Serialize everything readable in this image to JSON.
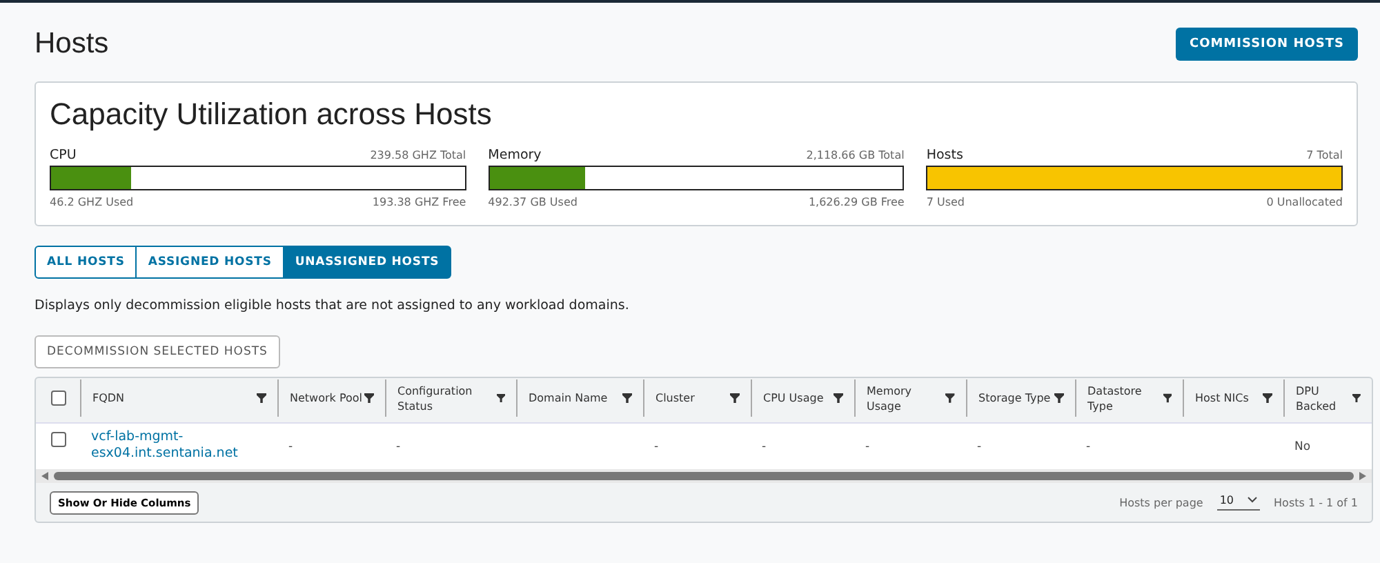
{
  "page": {
    "title": "Hosts",
    "action": "COMMISSION HOSTS"
  },
  "capacity": {
    "title": "Capacity Utilization across Hosts",
    "meters": [
      {
        "label": "CPU",
        "total": "239.58 GHZ Total",
        "level": 0.193,
        "used": "46.2 GHZ Used",
        "free": "193.38 GHZ Free",
        "color": "#4a9010"
      },
      {
        "label": "Memory",
        "total": "2,118.66 GB Total",
        "level": 0.232,
        "used": "492.37 GB Used",
        "free": "1,626.29 GB Free",
        "color": "#4a9010"
      },
      {
        "label": "Hosts",
        "total": "7 Total",
        "level": 1.0,
        "used": "7 Used",
        "free": "0 Unallocated",
        "color": "#f8c400"
      }
    ]
  },
  "tabs": [
    {
      "label": "ALL HOSTS",
      "selected": false
    },
    {
      "label": "ASSIGNED HOSTS",
      "selected": false
    },
    {
      "label": "UNASSIGNED HOSTS",
      "selected": true
    }
  ],
  "description": "Displays only decommission eligible hosts that are not assigned to any workload domains.",
  "decommission_button": "DECOMMISSION SELECTED HOSTS",
  "table": {
    "all_checked": false,
    "columns": [
      "FQDN",
      "Network Pool",
      "Configuration Status",
      "Domain Name",
      "Cluster",
      "CPU Usage",
      "Memory Usage",
      "Storage Type",
      "Datastore Type",
      "Host NICs",
      "DPU Backed"
    ],
    "rows": [
      {
        "checked": false,
        "cells": [
          "vcf-lab-mgmt-esx04.int.sentania.net",
          "-",
          "-",
          "",
          "-",
          "-",
          "-",
          "-",
          "-",
          "",
          "No"
        ]
      }
    ],
    "show_hide_button": "Show Or Hide Columns",
    "per_page_label": "Hosts per page",
    "per_page": "10",
    "range": "Hosts 1 - 1 of 1"
  }
}
